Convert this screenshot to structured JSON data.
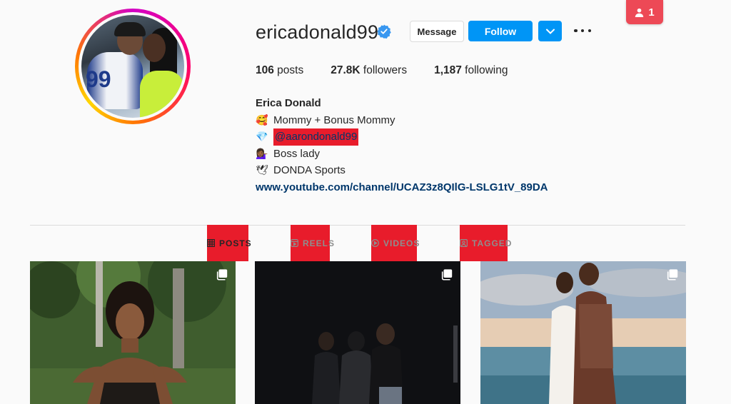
{
  "notification": {
    "count": "1",
    "icon": "person-icon"
  },
  "profile": {
    "username": "ericadonald99",
    "verified": true,
    "buttons": {
      "message": "Message",
      "follow": "Follow"
    },
    "stats": [
      {
        "value": "106",
        "label": " posts"
      },
      {
        "value": "27.8K",
        "label": " followers"
      },
      {
        "value": "1,187",
        "label": " following"
      }
    ],
    "bio": {
      "name": "Erica Donald",
      "lines": [
        {
          "emoji": "🥰",
          "text": "Mommy + Bonus Mommy"
        },
        {
          "emoji": "💎",
          "text": "@aarondonald99"
        },
        {
          "emoji": "💁🏾‍♀️",
          "text": "Boss lady"
        },
        {
          "emoji": "🕊",
          "text": "DONDA Sports"
        }
      ],
      "link": "www.youtube.com/channel/UCAZ3z8QIlG-LSLG1tV_89DA"
    }
  },
  "tabs": [
    {
      "label": "POSTS",
      "icon": "grid-icon"
    },
    {
      "label": "REELS",
      "icon": "reels-icon"
    },
    {
      "label": "VIDEOS",
      "icon": "video-icon"
    },
    {
      "label": "TAGGED",
      "icon": "tag-icon"
    }
  ],
  "colors": {
    "follow": "#0095f6",
    "badge": "#ed4956",
    "highlight": "#e81c2b",
    "link": "#00376b"
  }
}
